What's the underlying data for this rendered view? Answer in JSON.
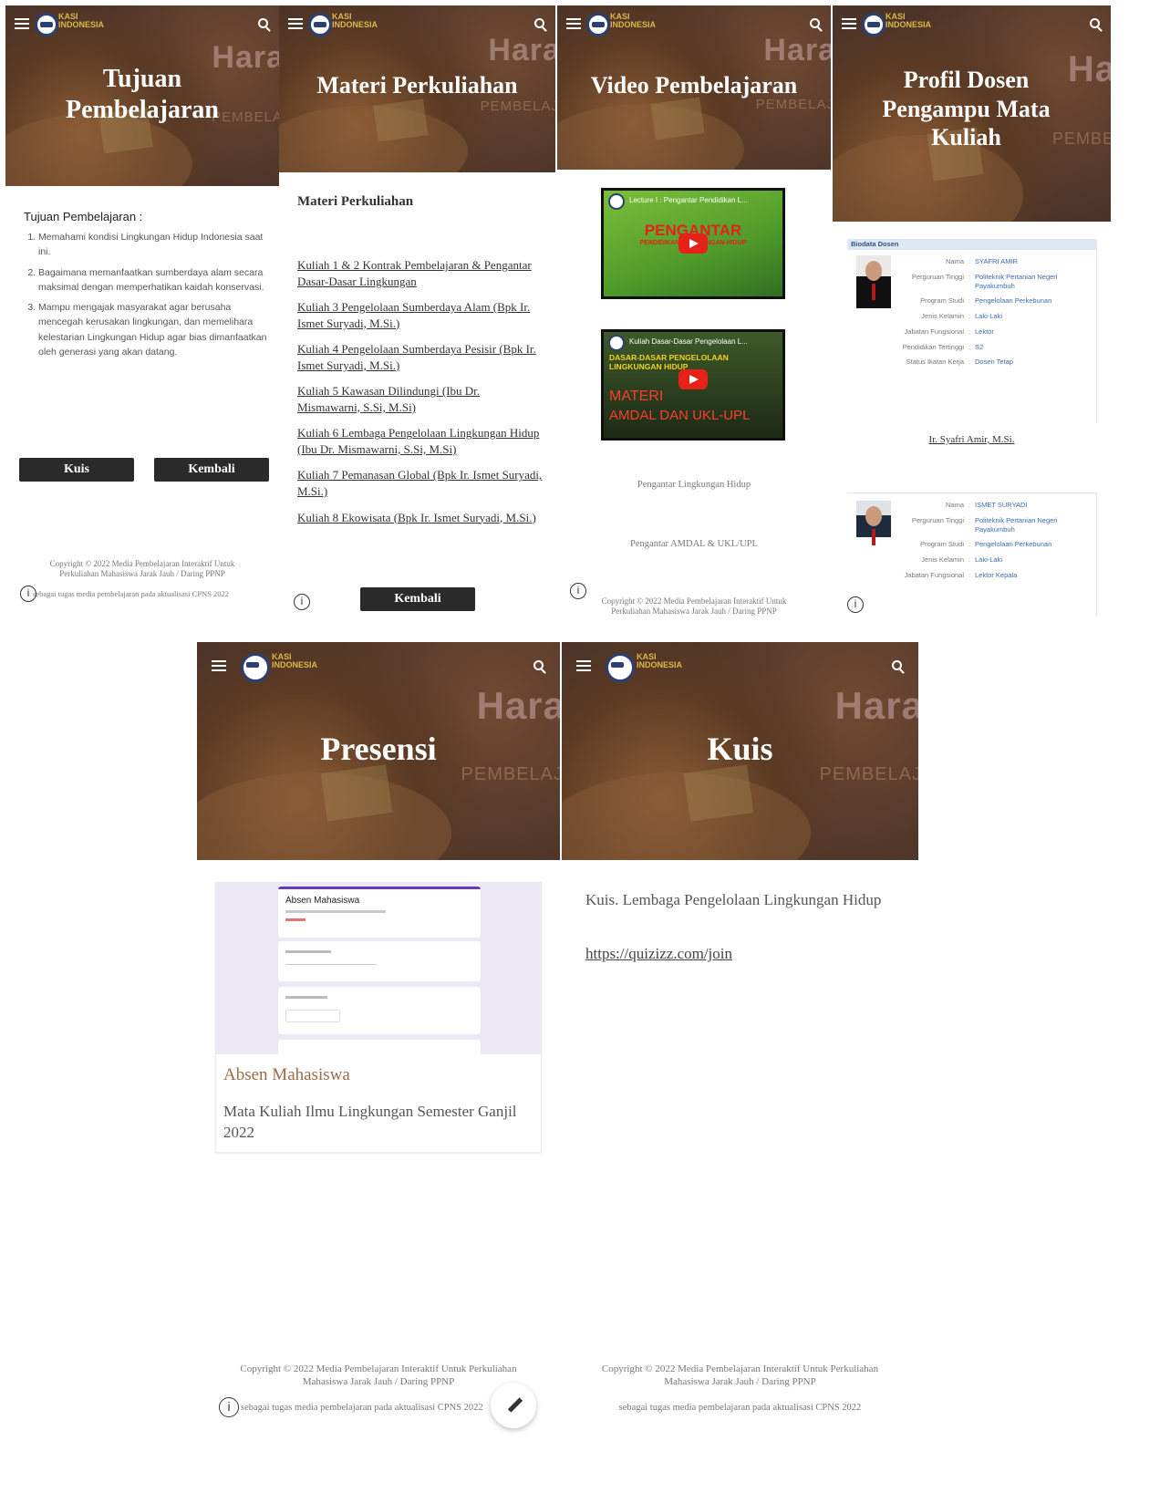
{
  "tujuan": {
    "hero_title": "Tujuan Pembelajaran",
    "bg_word": "Hara",
    "bg_sub": "PEMBELA",
    "heading": "Tujuan Pembelajaran :",
    "items": [
      "Memahami kondisi Lingkungan Hidup Indonesia saat ini.",
      "Bagaimana memanfaatkan sumberdaya alam secara maksimal dengan memperhatikan kaidah konservasi.",
      "Mampu mengajak masyarakat agar berusaha mencegah kerusakan lingkungan, dan memelihara kelestarian Lingkungan Hidup agar bias dimanfaatkan oleh generasi yang akan datang."
    ],
    "btn_kuis": "Kuis",
    "btn_kembali": "Kembali",
    "copyright": "Copyright © 2022 Media Pembelajaran Interaktif Untuk Perkuliahan Mahasiswa Jarak Jauh / Daring PPNP",
    "footer_note": "sebagai tugas media pembelajaran pada aktualisasi CPNS 2022"
  },
  "materi": {
    "hero_title": "Materi Perkuliahan",
    "bg_word": "Hara",
    "bg_sub": "PEMBELAJ",
    "heading": "Materi Perkuliahan",
    "links": [
      "Kuliah 1 & 2 Kontrak Pembelajaran & Pengantar Dasar-Dasar Lingkungan",
      "Kuliah 3 Pengelolaan Sumberdaya Alam (Bpk Ir. Ismet Suryadi, M.Si.)",
      "Kuliah 4 Pengelolaan Sumberdaya Pesisir (Bpk Ir. Ismet Suryadi, M.Si.)",
      "Kuliah 5 Kawasan Dilindungi (Ibu Dr. Mismawarni, S.Si, M.Si)",
      "Kuliah 6 Lembaga Pengelolaan Lingkungan Hidup (Ibu Dr. Mismawarni, S.Si, M.Si)",
      "Kuliah 7 Pemanasan Global (Bpk Ir. Ismet Suryadi, M.Si.)",
      "Kuliah 8 Ekowisata (Bpk Ir. Ismet Suryadi, M.Si.)"
    ],
    "btn_kembali": "Kembali"
  },
  "video": {
    "hero_title": "Video Pembelajaran",
    "bg_word": "Hara",
    "bg_sub": "PEMBELAJ",
    "videos": [
      {
        "title": "Lecture I : Pengantar Pendidikan L...",
        "big": "PENGANTAR",
        "small": "PENDIDIKAN LINGKUNGAN HIDUP",
        "caption": "Pengantar Lingkungan Hidup"
      },
      {
        "title": "Kuliah Dasar-Dasar Pengelolaan L...",
        "big": "MATERI",
        "line2": "AMDAL DAN UKL-UPL",
        "small": "DASAR-DASAR PENGELOLAAN LINGKUNGAN HIDUP",
        "caption": "Pengantar AMDAL & UKL/UPL"
      }
    ],
    "copyright": "Copyright © 2022 Media Pembelajaran Interaktif Untuk Perkuliahan Mahasiswa Jarak Jauh / Daring PPNP"
  },
  "profil": {
    "hero_title": "Profil Dosen Pengampu Mata Kuliah",
    "bg_word": "Ha",
    "bg_sub": "PEMBE",
    "section": "Biodata Dosen",
    "dosen1": {
      "rows": [
        {
          "k": "Nama",
          "v": "SYAFRI AMIR"
        },
        {
          "k": "Perguruan Tinggi",
          "v": "Politeknik Pertanian Negeri Payakumbuh"
        },
        {
          "k": "Program Studi",
          "v": "Pengelolaan Perkebunan"
        },
        {
          "k": "Jenis Kelamin",
          "v": "Laki-Laki"
        },
        {
          "k": "Jabatan Fungsional",
          "v": "Lektor"
        },
        {
          "k": "Pendidikan Tertinggi",
          "v": "S2"
        },
        {
          "k": "Status Ikatan Kerja",
          "v": "Dosen Tetap"
        }
      ],
      "name_link": "Ir. Syafri Amir, M.Si."
    },
    "dosen2": {
      "rows": [
        {
          "k": "Nama",
          "v": "ISMET SURYADI"
        },
        {
          "k": "Perguruan Tinggi",
          "v": "Politeknik Pertanian Negeri Payakumbuh"
        },
        {
          "k": "Program Studi",
          "v": "Pengelolaan Perkebunan"
        },
        {
          "k": "Jenis Kelamin",
          "v": "Laki-Laki"
        },
        {
          "k": "Jabatan Fungsional",
          "v": "Lektor Kepala"
        }
      ]
    }
  },
  "presensi": {
    "hero_title": "Presensi",
    "bg_word": "Hara",
    "bg_sub": "PEMBELAJ",
    "form_title": "Absen Mahasiswa",
    "card_title": "Absen Mahasiswa",
    "card_desc": "Mata Kuliah Ilmu Lingkungan Semester Ganjil 2022",
    "copyright": "Copyright © 2022 Media Pembelajaran Interaktif Untuk Perkuliahan Mahasiswa Jarak Jauh / Daring PPNP",
    "footer_note": "sebagai tugas media pembelajaran pada aktualisasi CPNS 2022"
  },
  "kuis": {
    "hero_title": "Kuis",
    "bg_word": "Hara",
    "bg_sub": "PEMBELAJ",
    "text": "Kuis. Lembaga Pengelolaan Lingkungan Hidup",
    "link": "https://quizizz.com/join",
    "copyright": "Copyright © 2022 Media Pembelajaran Interaktif Untuk Perkuliahan Mahasiswa Jarak Jauh / Daring PPNP",
    "footer_note": "sebagai tugas media pembelajaran pada aktualisasi CPNS 2022"
  },
  "brand_text": "KASI INDONESIA",
  "info_glyph": "i",
  "colors": {
    "hero_dark": "#3f2b22",
    "button": "#2a2a2a",
    "link_blue": "#3d6ab1",
    "accent_brown": "#9a6b4a"
  }
}
